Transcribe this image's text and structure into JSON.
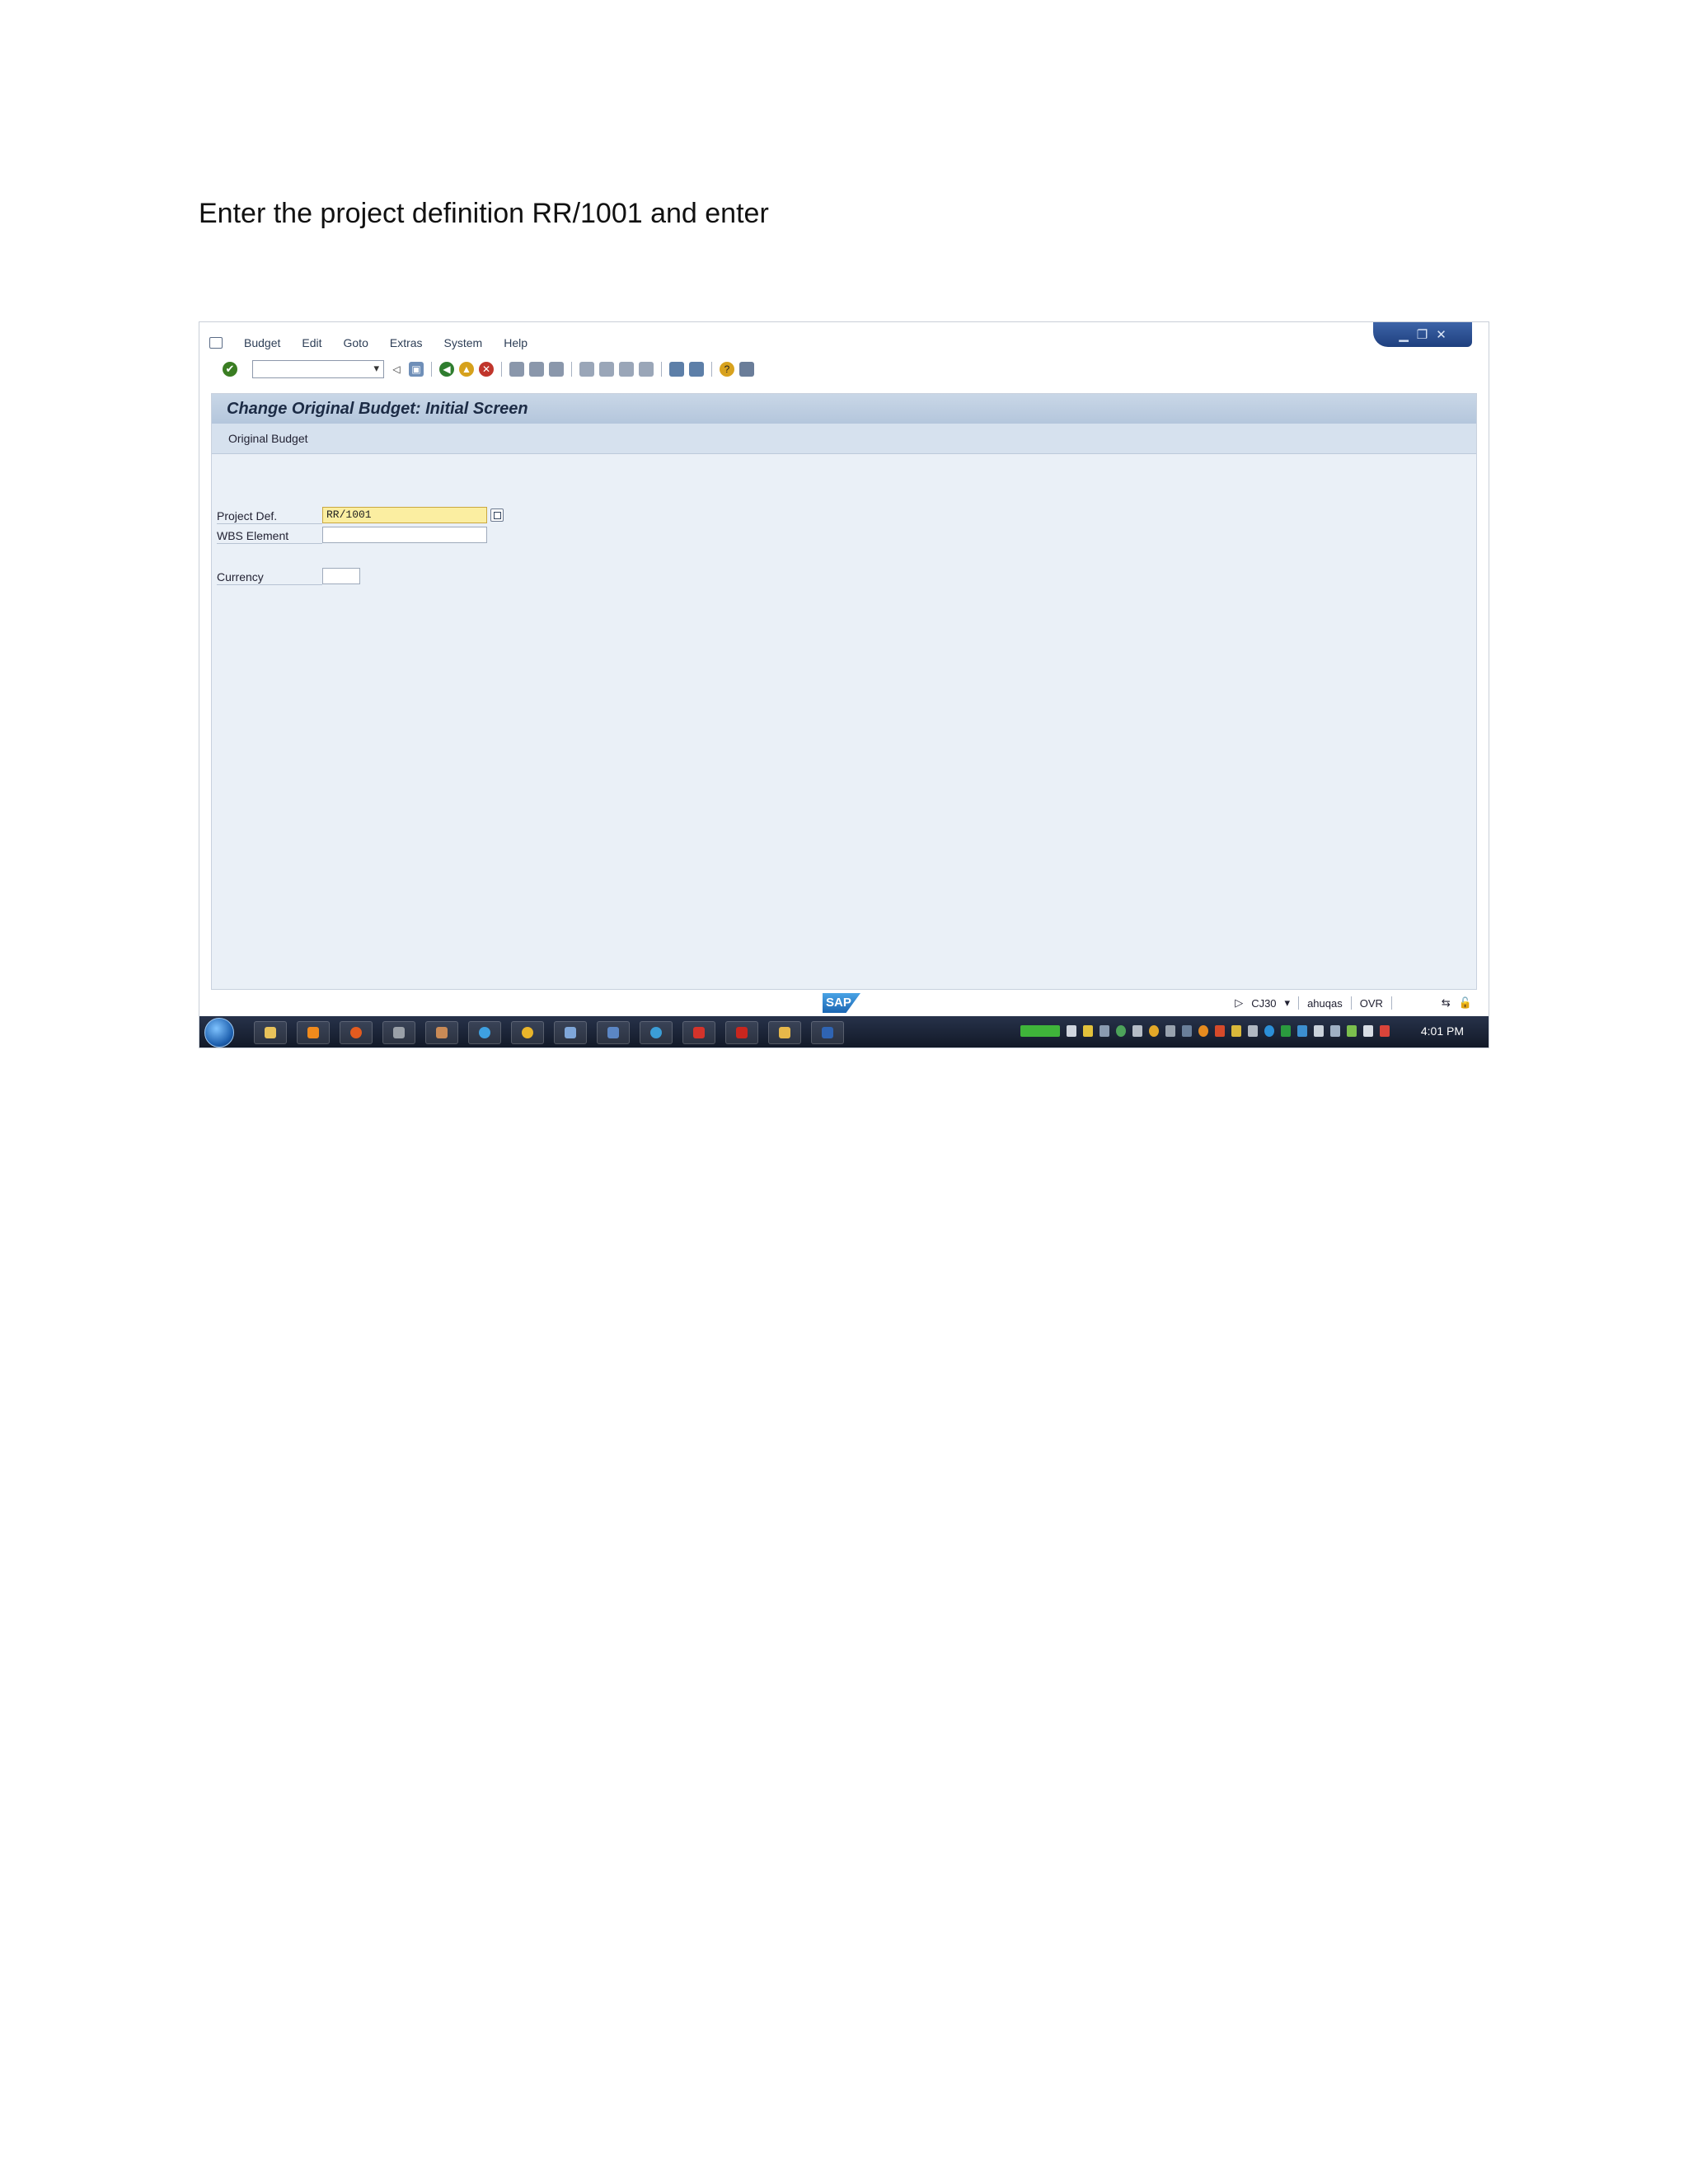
{
  "instruction": "Enter the project definition RR/1001 and enter",
  "menu": {
    "items": [
      "Budget",
      "Edit",
      "Goto",
      "Extras",
      "System",
      "Help"
    ]
  },
  "screen": {
    "title": "Change Original Budget: Initial Screen",
    "app_toolbar_label": "Original Budget"
  },
  "form": {
    "project_def_label": "Project Def.",
    "project_def_value": "RR/1001",
    "wbs_element_label": "WBS Element",
    "wbs_element_value": "",
    "currency_label": "Currency",
    "currency_value": ""
  },
  "statusbar": {
    "logo_text": "SAP",
    "transaction": "CJ30",
    "user": "ahuqas",
    "mode": "OVR"
  },
  "taskbar": {
    "clock": "4:01 PM"
  }
}
